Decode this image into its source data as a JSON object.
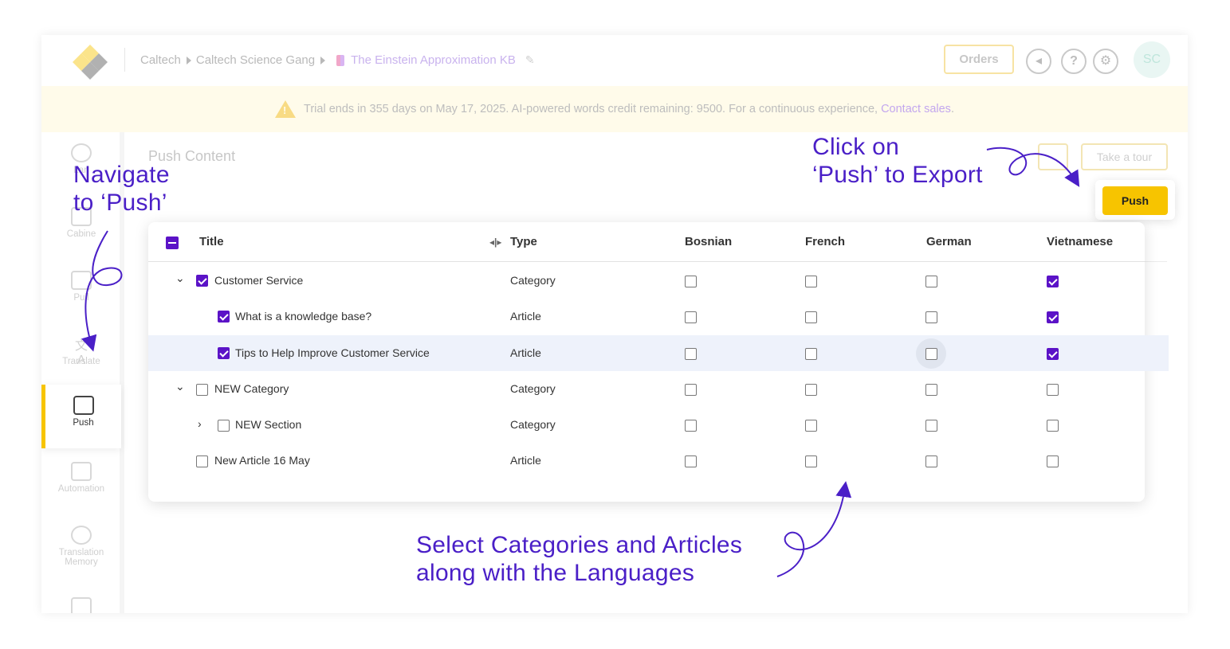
{
  "breadcrumb": {
    "items": [
      "Caltech",
      "Caltech Science Gang"
    ],
    "kb_name": "The Einstein Approximation KB"
  },
  "header": {
    "orders_label": "Orders",
    "avatar_initials": "SC"
  },
  "banner": {
    "text": "Trial ends in 355 days on May 17, 2025. AI-powered words credit remaining: 9500. For a continuous experience,",
    "link": "Contact sales",
    "suffix": "."
  },
  "sidebar": {
    "items": [
      {
        "label": "Lan"
      },
      {
        "label": "Cabine"
      },
      {
        "label": "Pull"
      },
      {
        "label": "Translate"
      },
      {
        "label": "Push"
      },
      {
        "label": "Automation"
      },
      {
        "label": "Translation Memory"
      }
    ]
  },
  "page": {
    "title": "Push Content",
    "tour_label": "Take a tour",
    "push_label": "Push"
  },
  "table": {
    "headers": {
      "title": "Title",
      "type": "Type",
      "languages": [
        "Bosnian",
        "French",
        "German",
        "Vietnamese"
      ]
    },
    "rows": [
      {
        "title": "Customer Service",
        "type": "Category",
        "checked": true,
        "langs": [
          false,
          false,
          false,
          true
        ]
      },
      {
        "title": "What is a knowledge base?",
        "type": "Article",
        "checked": true,
        "langs": [
          false,
          false,
          false,
          true
        ]
      },
      {
        "title": "Tips to Help Improve Customer Service",
        "type": "Article",
        "checked": true,
        "langs": [
          false,
          false,
          false,
          true
        ]
      },
      {
        "title": "NEW Category",
        "type": "Category",
        "checked": false,
        "langs": [
          false,
          false,
          false,
          false
        ]
      },
      {
        "title": "NEW Section",
        "type": "Category",
        "checked": false,
        "langs": [
          false,
          false,
          false,
          false
        ]
      },
      {
        "title": "New Article 16 May",
        "type": "Article",
        "checked": false,
        "langs": [
          false,
          false,
          false,
          false
        ]
      }
    ]
  },
  "annotations": {
    "navigate_line1": "Navigate",
    "navigate_line2": "to ‘Push’",
    "click_line1": "Click on",
    "click_line2": "‘Push’ to Export",
    "select_line1": "Select Categories and Articles",
    "select_line2": "along with the Languages"
  },
  "colors": {
    "accent": "#f7c400",
    "checkbox": "#5b13c7",
    "annotation": "#4a1fc7"
  }
}
